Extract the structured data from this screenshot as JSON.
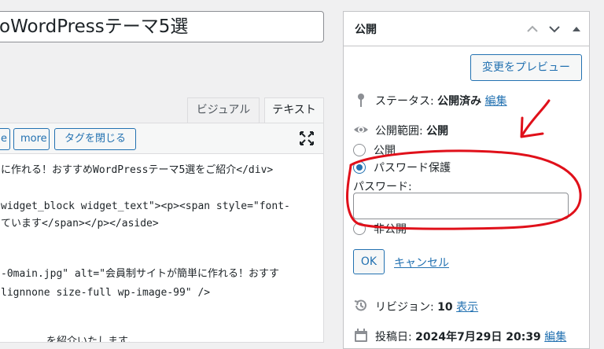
{
  "title_input": {
    "value": "oWordPressテーマ5選"
  },
  "editor_tabs": {
    "visual": "ビジュアル",
    "text": "テキスト"
  },
  "quicktags": {
    "e_partial": "e",
    "more": "more",
    "close_tags": "タグを閉じる"
  },
  "code_lines": [
    "に作れる！おすすめWordPressテーマ5選をご紹介</div>",
    "",
    "widget_block widget_text\"><p><span style=\"font-",
    "ています</span></p></aside>",
    "",
    "",
    "-0main.jpg\" alt=\"会員制サイトが簡単に作れる！おすす",
    "lignnone size-full wp-image-99\" />",
    "",
    "",
    "を紹介いたします。"
  ],
  "publish": {
    "title": "公開",
    "preview_button": "変更をプレビュー",
    "status": {
      "label": "ステータス:",
      "value": "公開済み",
      "edit": "編集"
    },
    "visibility": {
      "label": "公開範囲:",
      "value": "公開"
    },
    "options": [
      {
        "label": "公開",
        "checked": false
      },
      {
        "label": "パスワード保護",
        "checked": true
      },
      {
        "label": "非公開",
        "checked": false
      }
    ],
    "password_label": "パスワード:",
    "password_value": "",
    "ok_button": "OK",
    "cancel_link": "キャンセル",
    "revisions": {
      "label": "リビジョン:",
      "count": "10",
      "link": "表示"
    },
    "published_on": {
      "label": "投稿日:",
      "value": "2024年7月29日 20:39",
      "edit": "編集"
    }
  },
  "colors": {
    "accent": "#2271b1",
    "annotation": "#e0101a"
  }
}
